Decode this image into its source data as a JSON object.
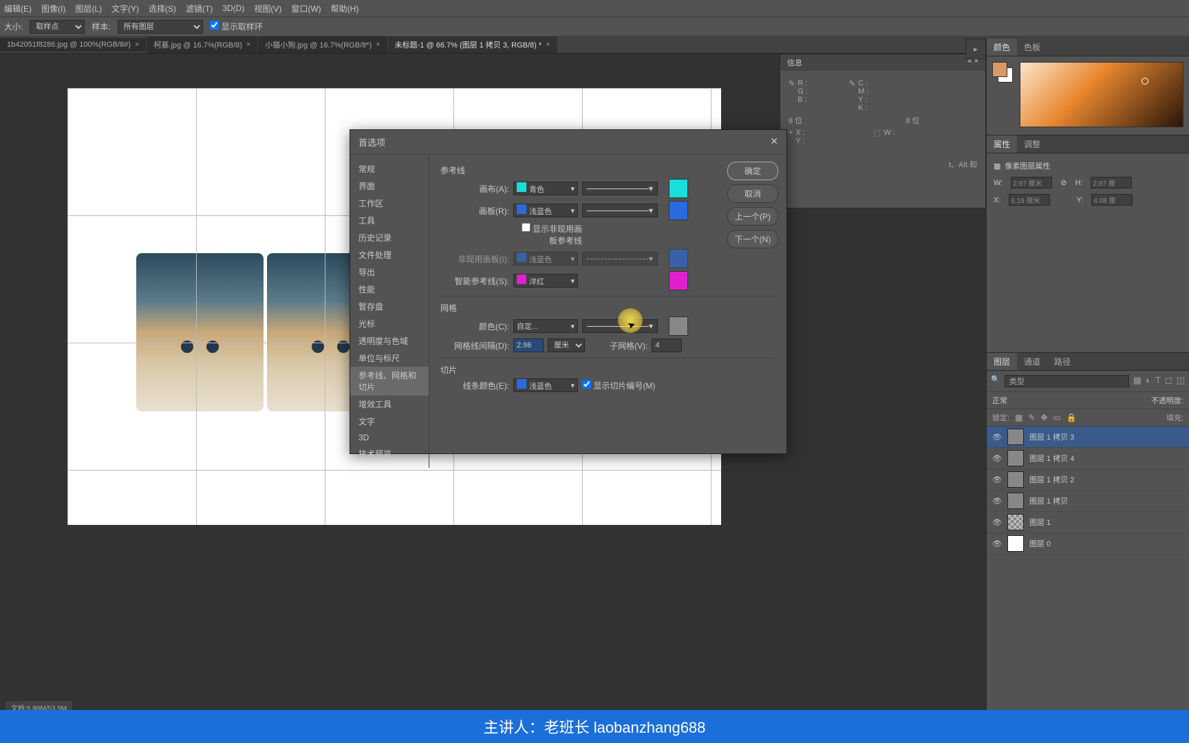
{
  "menu": [
    "编辑(E)",
    "图像(I)",
    "图层(L)",
    "文字(Y)",
    "选择(S)",
    "滤镜(T)",
    "3D(D)",
    "视图(V)",
    "窗口(W)",
    "帮助(H)"
  ],
  "toolbar": {
    "size_label": "大小:",
    "size_opt": "取样点",
    "sample_label": "样本:",
    "sample_opt": "所有图层",
    "ring_label": "显示取样环"
  },
  "tabs": [
    {
      "label": "1b42051f8286.jpg @ 100%(RGB/8#)",
      "active": false
    },
    {
      "label": "柯基.jpg @ 16.7%(RGB/8)",
      "active": false
    },
    {
      "label": "小猫小狗.jpg @ 16.7%(RGB/8*)",
      "active": false
    },
    {
      "label": "未标题-1 @ 66.7% (图层 1 拷贝 3, RGB/8) *",
      "active": true
    }
  ],
  "info": {
    "title": "信息",
    "r": "R :",
    "g": "G :",
    "b": "B :",
    "c": "C :",
    "m": "M :",
    "y": "Y :",
    "k": "K :",
    "bit": "8 位",
    "bit2": "8 位",
    "x": "X :",
    "yy": "Y :",
    "w": "W :",
    "note": "t、Alt 和"
  },
  "color_tab": {
    "c": "颜色",
    "s": "色板"
  },
  "props": {
    "t_props": "属性",
    "t_adj": "调整",
    "title": "像素图层属性",
    "w": "W:",
    "wv": "2.97 厘米",
    "h": "H:",
    "hv": "2.97 厘",
    "x": "X:",
    "xv": "6.19 厘米",
    "y": "Y:",
    "yv": "4.08 厘"
  },
  "layers": {
    "t_layers": "图层",
    "t_chan": "通道",
    "t_path": "路径",
    "search": "类型",
    "blend": "正常",
    "opacity_lbl": "不透明度:",
    "lock_lbl": "锁定:",
    "fill_lbl": "填充:",
    "items": [
      {
        "name": "图层 1 拷贝 3",
        "sel": true,
        "thumb": "img"
      },
      {
        "name": "图层 1 拷贝 4",
        "sel": false,
        "thumb": "img"
      },
      {
        "name": "图层 1 拷贝 2",
        "sel": false,
        "thumb": "img"
      },
      {
        "name": "图层 1 拷贝",
        "sel": false,
        "thumb": "img"
      },
      {
        "name": "图层 1",
        "sel": false,
        "thumb": "trans"
      },
      {
        "name": "图层 0",
        "sel": false,
        "thumb": "white"
      }
    ]
  },
  "dialog": {
    "title": "首选项",
    "sidebar": [
      "常规",
      "界面",
      "工作区",
      "工具",
      "历史记录",
      "文件处理",
      "导出",
      "性能",
      "暂存盘",
      "光标",
      "透明度与色域",
      "单位与标尺",
      "参考线、网格和切片",
      "增效工具",
      "文字",
      "3D",
      "技术预览"
    ],
    "sidebar_sel": 12,
    "btns": {
      "ok": "确定",
      "cancel": "取消",
      "prev": "上一个(P)",
      "next": "下一个(N)"
    },
    "sect_guides": "参考线",
    "canvas_lbl": "画布(A):",
    "canvas_val": "青色",
    "canvas_color": "#1adddd",
    "artboard_lbl": "画板(R):",
    "artboard_val": "浅蓝色",
    "artboard_color": "#2a6ae0",
    "show_inactive": "显示非现用画板参考线",
    "inactive_lbl": "非现用画板(I):",
    "inactive_val": "浅蓝色",
    "inactive_color": "#2a6ae0",
    "smart_lbl": "智能参考线(S):",
    "smart_val": "洋红",
    "smart_color": "#e020d0",
    "sect_grid": "网格",
    "grid_color_lbl": "颜色(C):",
    "grid_color_val": "自定...",
    "grid_color": "#888888",
    "grid_every_lbl": "网格线间隔(D):",
    "grid_every_val": "2.96",
    "grid_unit": "厘米",
    "subdiv_lbl": "子网格(V):",
    "subdiv_val": "4",
    "sect_slice": "切片",
    "slice_color_lbl": "线条颜色(E):",
    "slice_color_val": "浅蓝色",
    "slice_num": "显示切片编号(M)"
  },
  "statusbar": "文档:5.99M/53.5M",
  "footer": "主讲人：老班长 laobanzhang688"
}
